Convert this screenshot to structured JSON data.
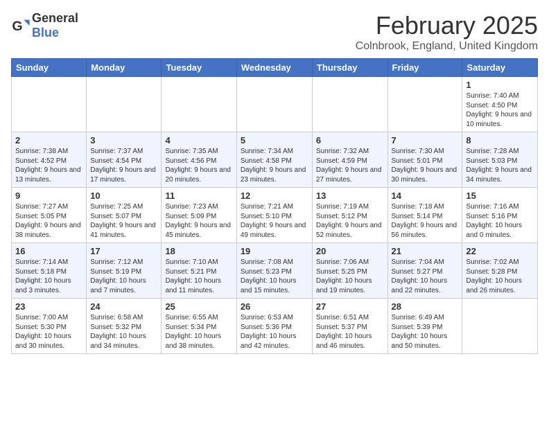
{
  "header": {
    "logo": {
      "general": "General",
      "blue": "Blue"
    },
    "month": "February 2025",
    "location": "Colnbrook, England, United Kingdom"
  },
  "weekdays": [
    "Sunday",
    "Monday",
    "Tuesday",
    "Wednesday",
    "Thursday",
    "Friday",
    "Saturday"
  ],
  "weeks": [
    [
      {
        "day": "",
        "info": ""
      },
      {
        "day": "",
        "info": ""
      },
      {
        "day": "",
        "info": ""
      },
      {
        "day": "",
        "info": ""
      },
      {
        "day": "",
        "info": ""
      },
      {
        "day": "",
        "info": ""
      },
      {
        "day": "1",
        "info": "Sunrise: 7:40 AM\nSunset: 4:50 PM\nDaylight: 9 hours\nand 10 minutes."
      }
    ],
    [
      {
        "day": "2",
        "info": "Sunrise: 7:38 AM\nSunset: 4:52 PM\nDaylight: 9 hours\nand 13 minutes."
      },
      {
        "day": "3",
        "info": "Sunrise: 7:37 AM\nSunset: 4:54 PM\nDaylight: 9 hours\nand 17 minutes."
      },
      {
        "day": "4",
        "info": "Sunrise: 7:35 AM\nSunset: 4:56 PM\nDaylight: 9 hours\nand 20 minutes."
      },
      {
        "day": "5",
        "info": "Sunrise: 7:34 AM\nSunset: 4:58 PM\nDaylight: 9 hours\nand 23 minutes."
      },
      {
        "day": "6",
        "info": "Sunrise: 7:32 AM\nSunset: 4:59 PM\nDaylight: 9 hours\nand 27 minutes."
      },
      {
        "day": "7",
        "info": "Sunrise: 7:30 AM\nSunset: 5:01 PM\nDaylight: 9 hours\nand 30 minutes."
      },
      {
        "day": "8",
        "info": "Sunrise: 7:28 AM\nSunset: 5:03 PM\nDaylight: 9 hours\nand 34 minutes."
      }
    ],
    [
      {
        "day": "9",
        "info": "Sunrise: 7:27 AM\nSunset: 5:05 PM\nDaylight: 9 hours\nand 38 minutes."
      },
      {
        "day": "10",
        "info": "Sunrise: 7:25 AM\nSunset: 5:07 PM\nDaylight: 9 hours\nand 41 minutes."
      },
      {
        "day": "11",
        "info": "Sunrise: 7:23 AM\nSunset: 5:09 PM\nDaylight: 9 hours\nand 45 minutes."
      },
      {
        "day": "12",
        "info": "Sunrise: 7:21 AM\nSunset: 5:10 PM\nDaylight: 9 hours\nand 49 minutes."
      },
      {
        "day": "13",
        "info": "Sunrise: 7:19 AM\nSunset: 5:12 PM\nDaylight: 9 hours\nand 52 minutes."
      },
      {
        "day": "14",
        "info": "Sunrise: 7:18 AM\nSunset: 5:14 PM\nDaylight: 9 hours\nand 56 minutes."
      },
      {
        "day": "15",
        "info": "Sunrise: 7:16 AM\nSunset: 5:16 PM\nDaylight: 10 hours\nand 0 minutes."
      }
    ],
    [
      {
        "day": "16",
        "info": "Sunrise: 7:14 AM\nSunset: 5:18 PM\nDaylight: 10 hours\nand 3 minutes."
      },
      {
        "day": "17",
        "info": "Sunrise: 7:12 AM\nSunset: 5:19 PM\nDaylight: 10 hours\nand 7 minutes."
      },
      {
        "day": "18",
        "info": "Sunrise: 7:10 AM\nSunset: 5:21 PM\nDaylight: 10 hours\nand 11 minutes."
      },
      {
        "day": "19",
        "info": "Sunrise: 7:08 AM\nSunset: 5:23 PM\nDaylight: 10 hours\nand 15 minutes."
      },
      {
        "day": "20",
        "info": "Sunrise: 7:06 AM\nSunset: 5:25 PM\nDaylight: 10 hours\nand 19 minutes."
      },
      {
        "day": "21",
        "info": "Sunrise: 7:04 AM\nSunset: 5:27 PM\nDaylight: 10 hours\nand 22 minutes."
      },
      {
        "day": "22",
        "info": "Sunrise: 7:02 AM\nSunset: 5:28 PM\nDaylight: 10 hours\nand 26 minutes."
      }
    ],
    [
      {
        "day": "23",
        "info": "Sunrise: 7:00 AM\nSunset: 5:30 PM\nDaylight: 10 hours\nand 30 minutes."
      },
      {
        "day": "24",
        "info": "Sunrise: 6:58 AM\nSunset: 5:32 PM\nDaylight: 10 hours\nand 34 minutes."
      },
      {
        "day": "25",
        "info": "Sunrise: 6:55 AM\nSunset: 5:34 PM\nDaylight: 10 hours\nand 38 minutes."
      },
      {
        "day": "26",
        "info": "Sunrise: 6:53 AM\nSunset: 5:36 PM\nDaylight: 10 hours\nand 42 minutes."
      },
      {
        "day": "27",
        "info": "Sunrise: 6:51 AM\nSunset: 5:37 PM\nDaylight: 10 hours\nand 46 minutes."
      },
      {
        "day": "28",
        "info": "Sunrise: 6:49 AM\nSunset: 5:39 PM\nDaylight: 10 hours\nand 50 minutes."
      },
      {
        "day": "",
        "info": ""
      }
    ]
  ]
}
